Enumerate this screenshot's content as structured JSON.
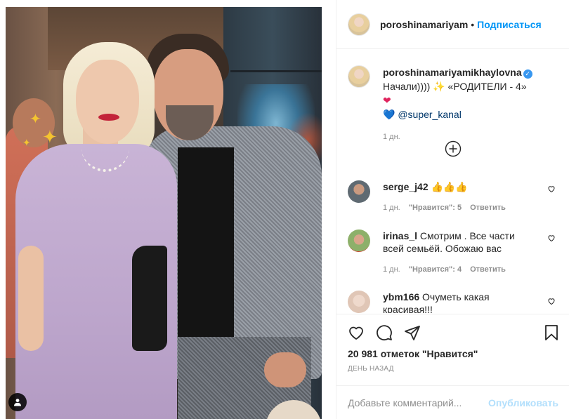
{
  "post": {
    "author": "poroshinamariyam",
    "follow_label": "Подписаться",
    "separator": "•"
  },
  "caption": {
    "username": "poroshinamariyamikhaylovna",
    "text_1": "Начали)))) ",
    "sparkles": "✨",
    "text_2": " «РОДИТЕЛИ - 4» ",
    "heart": "❤",
    "blue_heart": "💙",
    "mention": " @super_kanal",
    "time": "1 дн."
  },
  "comments": [
    {
      "user": "serge_j42",
      "text": "👍👍👍",
      "time": "1 дн.",
      "likes": "\"Нравится\": 5",
      "reply": "Ответить"
    },
    {
      "user": "irinas_l",
      "text": " Смотрим . Все части всей семьёй. Обожаю вас",
      "time": "1 дн.",
      "likes": "\"Нравится\": 4",
      "reply": "Ответить"
    },
    {
      "user": "ybm166",
      "text": " Очуметь какая красивая!!!",
      "time": "",
      "likes": "",
      "reply": ""
    }
  ],
  "footer": {
    "likes_count": "20 981 отметок \"Нравится\"",
    "date": "ДЕНЬ НАЗАД",
    "comment_placeholder": "Добавьте комментарий...",
    "publish_label": "Опубликовать"
  },
  "icons": {
    "like": "heart-icon",
    "comment": "comment-icon",
    "share": "share-icon",
    "save": "bookmark-icon",
    "load_more": "plus-circle-icon",
    "tag": "user-tag-icon"
  },
  "colors": {
    "accent": "#0095f6",
    "muted": "#8e8e8e",
    "text": "#262626",
    "verified": "#3897f0",
    "publish_disabled": "#b2dffc"
  }
}
